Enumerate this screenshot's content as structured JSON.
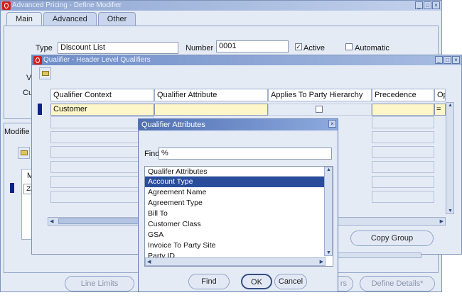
{
  "main_window": {
    "title": "Advanced Pricing - Define Modifier",
    "tabs": [
      "Main",
      "Advanced",
      "Other"
    ],
    "type_label": "Type",
    "type_value": "Discount List",
    "number_label": "Number",
    "number_value": "0001",
    "active_label": "Active",
    "active_checked": true,
    "automatic_label": "Automatic",
    "automatic_checked": false,
    "partial_label_v": "V",
    "partial_label_cu": "Cu",
    "modifiers_label": "Modifie",
    "partial_col_m": "M",
    "partial_row_value": "22",
    "buttons": {
      "line_limits": "Line Limits",
      "rs": "rs",
      "define_details": "Define Details*"
    }
  },
  "qualifier_window": {
    "title": "Qualifier - Header Level Qualifiers",
    "columns": [
      "Qualifier Context",
      "Qualifier Attribute",
      "Applies To Party Hierarchy",
      "Precedence",
      "Op"
    ],
    "first_row": {
      "context": "Customer",
      "attribute": "",
      "applies_to_party_hierarchy": false,
      "precedence": "",
      "op": "="
    },
    "copy_group_button": "Copy Group"
  },
  "attributes_dialog": {
    "title": "Qualifier Attributes",
    "find_label": "Find",
    "find_value": "%",
    "list_header": "Qualifer Attributes",
    "items": [
      "Account Type",
      "Agreement Name",
      "Agreement Type",
      "Bill To",
      "Customer Class",
      "GSA",
      "Invoice To Party Site",
      "Party ID"
    ],
    "selected_index": 0,
    "find_button": "Find",
    "ok_button": "OK",
    "cancel_button": "Cancel"
  },
  "colors": {
    "titlebar_active": "#6d8cc7",
    "panel": "#e5ebf5",
    "required_field": "#fcf6c8",
    "selection": "#2a4d9b"
  }
}
